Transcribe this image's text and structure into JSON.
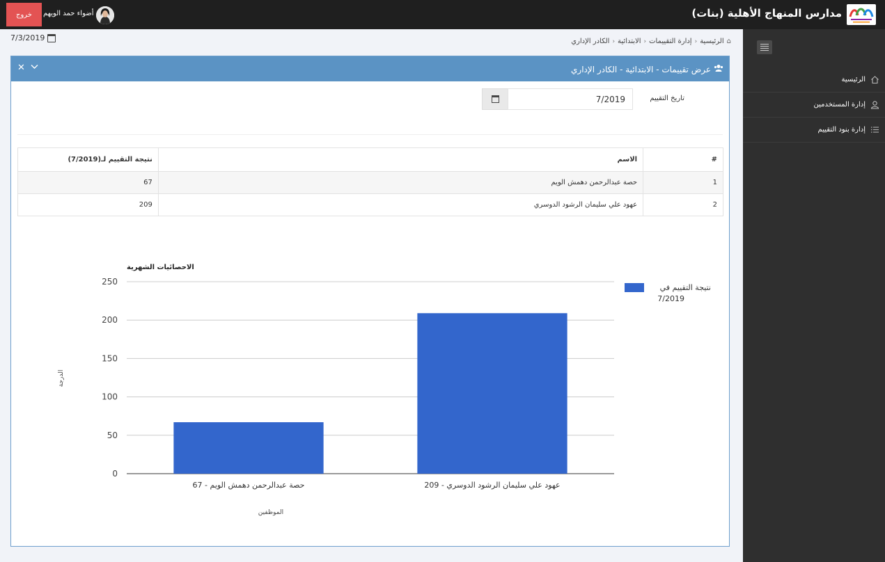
{
  "topbar": {
    "logout_label": "خروج",
    "user_name": "أضواء حمد الويهم",
    "brand_title": "مدارس المنهاج الأهلية (بنات)"
  },
  "sidebar": {
    "items": [
      {
        "label": "الرئيسية",
        "icon": "home-icon"
      },
      {
        "label": "إدارة المستخدمين",
        "icon": "user-icon"
      },
      {
        "label": "إدارة بنود التقييم",
        "icon": "list-icon"
      }
    ]
  },
  "header": {
    "current_date": "7/3/2019",
    "breadcrumb": [
      "الرئيسية",
      "إدارة التقييمات",
      "الابتدائية",
      "الكادر الإداري"
    ]
  },
  "panel": {
    "title": "عرض تقييمات - الابتدائية - الكادر الإداري",
    "date_label": "تاريخ التقييم",
    "date_value": "7/2019"
  },
  "table": {
    "headers": [
      "#",
      "الاسم",
      "نتيجة التقييم لـ(7/2019)"
    ],
    "rows": [
      {
        "num": "1",
        "name": "حصة عبدالرحمن دهمش الويم",
        "score": "67"
      },
      {
        "num": "2",
        "name": "عهود علي سليمان الرشود الدوسري",
        "score": "209"
      }
    ]
  },
  "chart_data": {
    "type": "bar",
    "title": "الاحصائيات الشهرية",
    "xlabel": "الموظفين",
    "ylabel": "الدرجة",
    "categories": [
      "حصة عبدالرحمن دهمش الويم - 67",
      "عهود علي سليمان الرشود الدوسري - 209"
    ],
    "series": [
      {
        "name": "نتيجة التقييم في 7/2019",
        "values": [
          67,
          209
        ],
        "color": "#3366cc"
      }
    ],
    "ylim": [
      0,
      250
    ],
    "yticks": [
      "0",
      "50",
      "100",
      "150",
      "200",
      "250"
    ],
    "grid": true,
    "legend": "right"
  }
}
